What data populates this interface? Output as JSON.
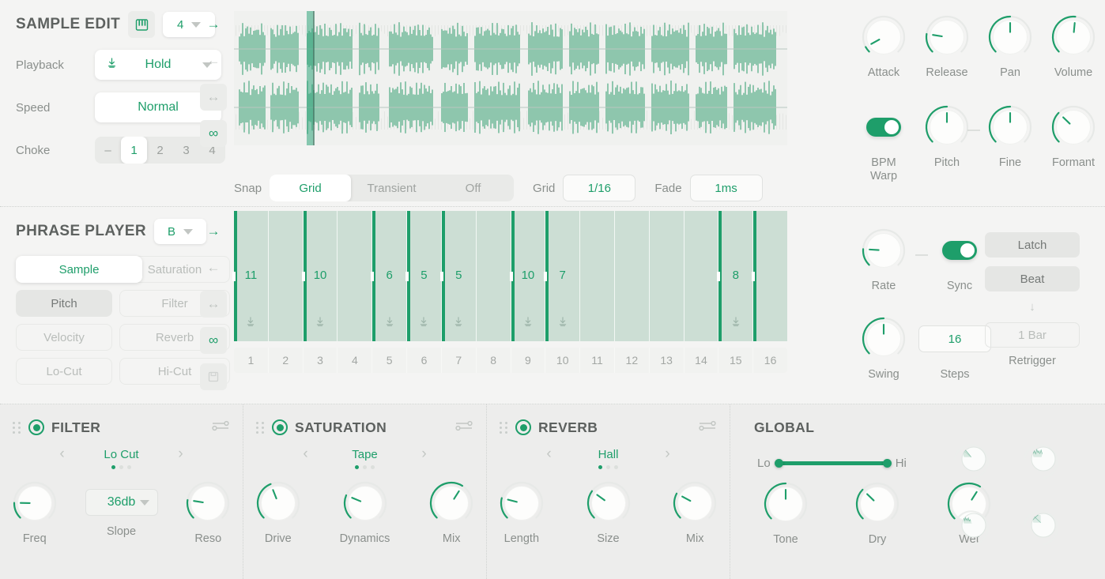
{
  "accent": "#1e9e6a",
  "sample_edit": {
    "title": "SAMPLE EDIT",
    "keyboard_icon": "piano-icon",
    "voice_value": "4",
    "rows": [
      {
        "label": "Playback",
        "value": "Hold",
        "icon": "download-icon"
      },
      {
        "label": "Speed",
        "value": "Normal"
      }
    ],
    "choke": {
      "label": "Choke",
      "options": [
        "–",
        "1",
        "2",
        "3",
        "4"
      ],
      "selected": "1"
    },
    "tools": [
      {
        "name": "arrow-right-icon",
        "glyph": "→",
        "state": "active"
      },
      {
        "name": "arrow-left-icon",
        "glyph": "←",
        "state": "inactive"
      },
      {
        "name": "arrows-horizontal-icon",
        "glyph": "↔",
        "state": "boxed"
      },
      {
        "name": "infinity-icon",
        "glyph": "∞",
        "state": "boxed-active"
      }
    ],
    "transport": {
      "snap_label": "Snap",
      "snap_options": [
        "Grid",
        "Transient",
        "Off"
      ],
      "snap_selected": "Grid",
      "grid_label": "Grid",
      "grid_value": "1/16",
      "fade_label": "Fade",
      "fade_value": "1ms"
    },
    "knobs_row1": [
      {
        "label": "Attack",
        "value": 0.06
      },
      {
        "label": "Release",
        "value": 0.2
      },
      {
        "label": "Pan",
        "value": 0.5
      },
      {
        "label": "Volume",
        "value": 0.52
      }
    ],
    "knobs_row2": [
      {
        "label": "BPM\nWarp",
        "type": "toggle",
        "on": true
      },
      {
        "label": "Pitch",
        "value": 0.5
      },
      {
        "label": "Fine",
        "value": 0.5
      },
      {
        "label": "Formant",
        "value": 0.33
      }
    ]
  },
  "phrase_player": {
    "title": "PHRASE PLAYER",
    "bank_value": "B",
    "tabs": [
      {
        "label": "Sample",
        "state": "selected"
      },
      {
        "label": "Saturation",
        "state": "off"
      },
      {
        "label": "Pitch",
        "state": "active"
      },
      {
        "label": "Filter",
        "state": "off"
      },
      {
        "label": "Velocity",
        "state": "off"
      },
      {
        "label": "Reverb",
        "state": "off"
      },
      {
        "label": "Lo-Cut",
        "state": "off"
      },
      {
        "label": "Hi-Cut",
        "state": "off"
      }
    ],
    "tools": [
      {
        "name": "arrow-right-icon",
        "glyph": "→",
        "state": "active"
      },
      {
        "name": "arrow-left-icon",
        "glyph": "←",
        "state": "inactive"
      },
      {
        "name": "arrows-horizontal-icon",
        "glyph": "↔",
        "state": "boxed"
      },
      {
        "name": "infinity-icon",
        "glyph": "∞",
        "state": "boxed-active"
      },
      {
        "name": "save-icon",
        "glyph": "⬚",
        "state": "boxed-faint"
      }
    ],
    "sequencer": {
      "steps": [
        {
          "step": 1,
          "note": "11",
          "trigger": true,
          "start": true
        },
        {
          "step": 2,
          "note": "",
          "trigger": false,
          "start": false
        },
        {
          "step": 3,
          "note": "10",
          "trigger": true,
          "start": true
        },
        {
          "step": 4,
          "note": "",
          "trigger": false,
          "start": false
        },
        {
          "step": 5,
          "note": "6",
          "trigger": true,
          "start": true
        },
        {
          "step": 6,
          "note": "5",
          "trigger": true,
          "start": true
        },
        {
          "step": 7,
          "note": "5",
          "trigger": true,
          "start": true
        },
        {
          "step": 8,
          "note": "",
          "trigger": false,
          "start": false
        },
        {
          "step": 9,
          "note": "10",
          "trigger": true,
          "start": true
        },
        {
          "step": 10,
          "note": "7",
          "trigger": true,
          "start": true
        },
        {
          "step": 11,
          "note": "",
          "trigger": false,
          "start": false
        },
        {
          "step": 12,
          "note": "",
          "trigger": false,
          "start": false
        },
        {
          "step": 13,
          "note": "",
          "trigger": false,
          "start": false
        },
        {
          "step": 14,
          "note": "",
          "trigger": false,
          "start": false
        },
        {
          "step": 15,
          "note": "8",
          "trigger": true,
          "start": true
        },
        {
          "step": 16,
          "note": "",
          "trigger": false,
          "start": true
        }
      ],
      "step_labels": [
        "1",
        "2",
        "3",
        "4",
        "5",
        "6",
        "7",
        "8",
        "9",
        "10",
        "11",
        "12",
        "13",
        "14",
        "15",
        "16"
      ]
    },
    "controls": {
      "rate": {
        "label": "Rate",
        "value": 0.18
      },
      "sync": {
        "label": "Sync",
        "on": true
      },
      "swing": {
        "label": "Swing",
        "value": 0.5
      },
      "steps": {
        "label": "Steps",
        "value": "16"
      },
      "latch_label": "Latch",
      "beat_label": "Beat",
      "retrigger_label": "Retrigger",
      "retrigger_value": "1 Bar",
      "down_arrow": "↓"
    }
  },
  "rack": {
    "panels": [
      {
        "title": "FILTER",
        "enabled": true,
        "preset": "Lo Cut",
        "preset_index": 0,
        "preset_count": 3,
        "controls": [
          {
            "type": "knob",
            "label": "Freq",
            "value": 0.17
          },
          {
            "type": "box",
            "label": "Slope",
            "value": "36db"
          },
          {
            "type": "knob",
            "label": "Reso",
            "value": 0.2
          }
        ]
      },
      {
        "title": "SATURATION",
        "enabled": true,
        "preset": "Tape",
        "preset_index": 0,
        "preset_count": 3,
        "controls": [
          {
            "type": "knob",
            "label": "Drive",
            "value": 0.42
          },
          {
            "type": "knob",
            "label": "Dynamics",
            "value": 0.25
          },
          {
            "type": "knob",
            "label": "Mix",
            "value": 0.62
          }
        ]
      },
      {
        "title": "REVERB",
        "enabled": true,
        "preset": "Hall",
        "preset_index": 0,
        "preset_count": 3,
        "controls": [
          {
            "type": "knob",
            "label": "Length",
            "value": 0.22
          },
          {
            "type": "knob",
            "label": "Size",
            "value": 0.3
          },
          {
            "type": "knob",
            "label": "Mix",
            "value": 0.27
          }
        ]
      }
    ],
    "global": {
      "title": "GLOBAL",
      "range_lo_label": "Lo",
      "range_hi_label": "Hi",
      "knobs": [
        {
          "label": "Tone",
          "value": 0.5
        },
        {
          "label": "Dry",
          "value": 0.33
        },
        {
          "label": "Wet",
          "value": 0.62
        }
      ],
      "visualizers": [
        {
          "name": "curve-down-viz-icon"
        },
        {
          "name": "waveform-viz-icon"
        },
        {
          "name": "spectrum-viz-icon"
        },
        {
          "name": "crossfade-viz-icon"
        }
      ]
    }
  }
}
